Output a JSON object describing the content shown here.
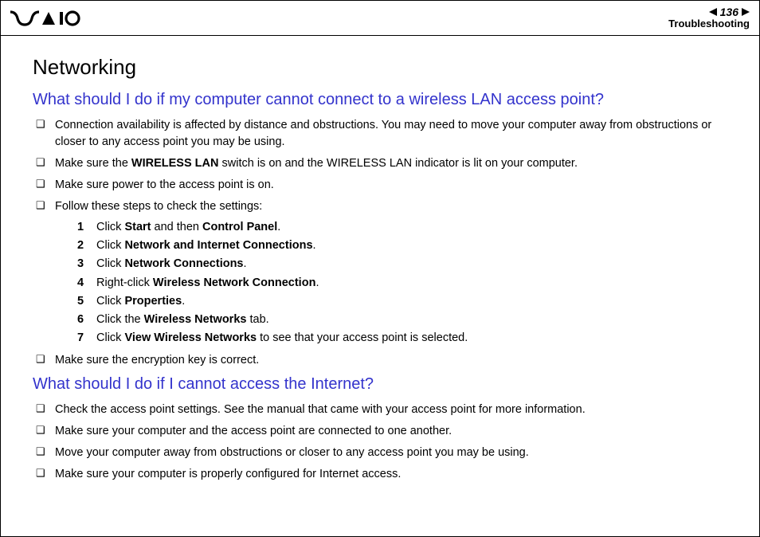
{
  "header": {
    "page_number": "136",
    "section": "Troubleshooting"
  },
  "section_title": "Networking",
  "q1": {
    "title": "What should I do if my computer cannot connect to a wireless LAN access point?",
    "b1": "Connection availability is affected by distance and obstructions. You may need to move your computer away from obstructions or closer to any access point you may be using.",
    "b2_pre": "Make sure the ",
    "b2_bold": "WIRELESS LAN",
    "b2_post": " switch is on and the WIRELESS LAN indicator is lit on your computer.",
    "b3": "Make sure power to the access point is on.",
    "b4": "Follow these steps to check the settings:",
    "steps": {
      "s1": {
        "n": "1",
        "pre": "Click ",
        "b1": "Start",
        "mid": " and then ",
        "b2": "Control Panel",
        "post": "."
      },
      "s2": {
        "n": "2",
        "pre": "Click ",
        "b1": "Network and Internet Connections",
        "post": "."
      },
      "s3": {
        "n": "3",
        "pre": "Click ",
        "b1": "Network Connections",
        "post": "."
      },
      "s4": {
        "n": "4",
        "pre": "Right-click ",
        "b1": "Wireless Network Connection",
        "post": "."
      },
      "s5": {
        "n": "5",
        "pre": "Click ",
        "b1": "Properties",
        "post": "."
      },
      "s6": {
        "n": "6",
        "pre": "Click the ",
        "b1": "Wireless Networks",
        "post": " tab."
      },
      "s7": {
        "n": "7",
        "pre": "Click ",
        "b1": "View Wireless Networks",
        "post": " to see that your access point is selected."
      }
    },
    "b5": "Make sure the encryption key is correct."
  },
  "q2": {
    "title": "What should I do if I cannot access the Internet?",
    "b1": "Check the access point settings. See the manual that came with your access point for more information.",
    "b2": "Make sure your computer and the access point are connected to one another.",
    "b3": "Move your computer away from obstructions or closer to any access point you may be using.",
    "b4": "Make sure your computer is properly configured for Internet access."
  }
}
